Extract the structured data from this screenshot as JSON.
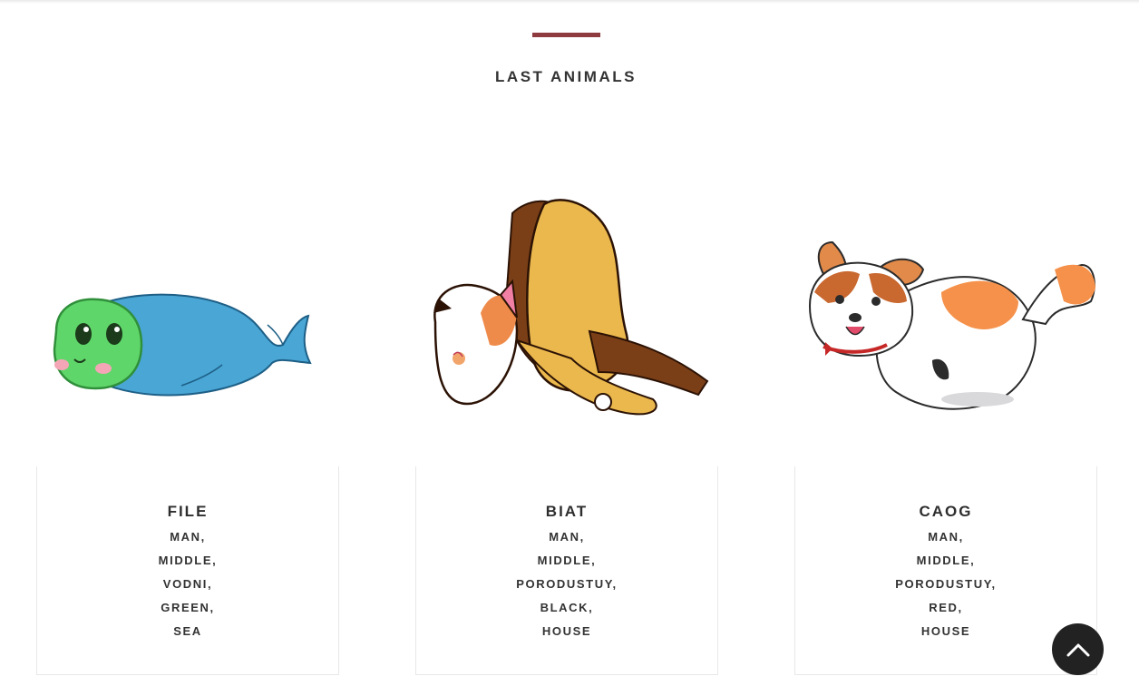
{
  "section": {
    "title": "LAST ANIMALS"
  },
  "colors": {
    "accent": "#8e3a3f",
    "heading": "#333333",
    "card_border": "#e8e8e8",
    "back_to_top_bg": "#222222"
  },
  "animals": [
    {
      "name": "FILE",
      "illustration": "green-jelly-whale-illustration",
      "tags": [
        "MAN,",
        "MIDDLE,",
        "VODNI,",
        "GREEN,",
        "SEA"
      ]
    },
    {
      "name": "BIAT",
      "illustration": "cat-bird-flying-illustration",
      "tags": [
        "MAN,",
        "MIDDLE,",
        "PORODUSTUY,",
        "BLACK,",
        "HOUSE"
      ]
    },
    {
      "name": "CAOG",
      "illustration": "corgi-cat-illustration",
      "tags": [
        "MAN,",
        "MIDDLE,",
        "PORODUSTUY,",
        "RED,",
        "HOUSE"
      ]
    }
  ],
  "back_to_top": {
    "icon": "chevron-up-icon"
  }
}
